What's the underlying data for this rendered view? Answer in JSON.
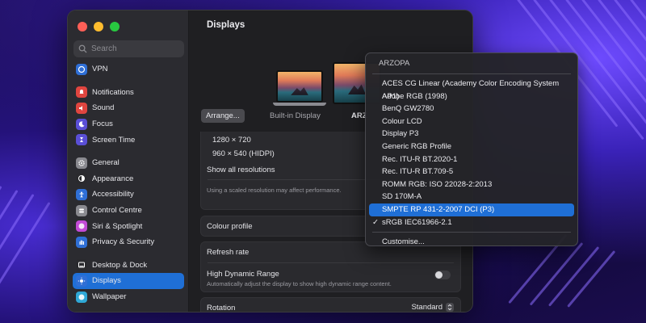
{
  "window": {
    "title": "Displays"
  },
  "sidebar": {
    "search_placeholder": "Search",
    "items": [
      {
        "label": "VPN",
        "icon": "vpn-icon",
        "color": "#2f6fd6"
      },
      {
        "label": "Notifications",
        "icon": "bell-icon",
        "color": "#e0453f"
      },
      {
        "label": "Sound",
        "icon": "speaker-icon",
        "color": "#e0453f"
      },
      {
        "label": "Focus",
        "icon": "moon-icon",
        "color": "#5a4fd6"
      },
      {
        "label": "Screen Time",
        "icon": "hourglass-icon",
        "color": "#5a4fd6"
      },
      {
        "label": "General",
        "icon": "gear-icon",
        "color": "#8a8a90"
      },
      {
        "label": "Appearance",
        "icon": "appearance-icon",
        "color": "#2a2a2e"
      },
      {
        "label": "Accessibility",
        "icon": "accessibility-icon",
        "color": "#2f6fd6"
      },
      {
        "label": "Control Centre",
        "icon": "control-centre-icon",
        "color": "#8a8a90"
      },
      {
        "label": "Siri & Spotlight",
        "icon": "siri-icon",
        "color": "#c24ad6"
      },
      {
        "label": "Privacy & Security",
        "icon": "hand-icon",
        "color": "#2f6fd6"
      },
      {
        "label": "Desktop & Dock",
        "icon": "dock-icon",
        "color": "#2a2a2e"
      },
      {
        "label": "Displays",
        "icon": "sun-icon",
        "color": "#2f6fd6"
      },
      {
        "label": "Wallpaper",
        "icon": "wallpaper-icon",
        "color": "#2fa8d6"
      }
    ]
  },
  "displays": {
    "arrange_label": "Arrange...",
    "builtin_label": "Built-in Display",
    "external_label_partial": "ARZ"
  },
  "resolutions": {
    "options": [
      "1280 × 720",
      "960 × 540 (HIDPI)"
    ],
    "show_all": "Show all resolutions",
    "note": "Using a scaled resolution may affect performance."
  },
  "settings": {
    "colour_profile": "Colour profile",
    "refresh_rate": "Refresh rate",
    "hdr_label": "High Dynamic Range",
    "hdr_desc": "Automatically adjust the display to show high dynamic range content.",
    "rotation_label": "Rotation",
    "rotation_value": "Standard"
  },
  "menu": {
    "header": "ARZOPA",
    "items": [
      "ACES CG Linear (Academy Color Encoding System AP1)",
      "Adobe RGB (1998)",
      "BenQ GW2780",
      "Colour LCD",
      "Display P3",
      "Generic RGB Profile",
      "Rec. ITU-R BT.2020-1",
      "Rec. ITU-R BT.709-5",
      "ROMM RGB: ISO 22028-2:2013",
      "SD 170M-A",
      "SMPTE RP 431-2-2007 DCI (P3)",
      "sRGB IEC61966-2.1"
    ],
    "highlighted": "SMPTE RP 431-2-2007 DCI (P3)",
    "checked": "sRGB IEC61966-2.1",
    "check_mark": "✓",
    "customise": "Customise..."
  },
  "colors": {
    "accent": "#1f6fd6"
  }
}
